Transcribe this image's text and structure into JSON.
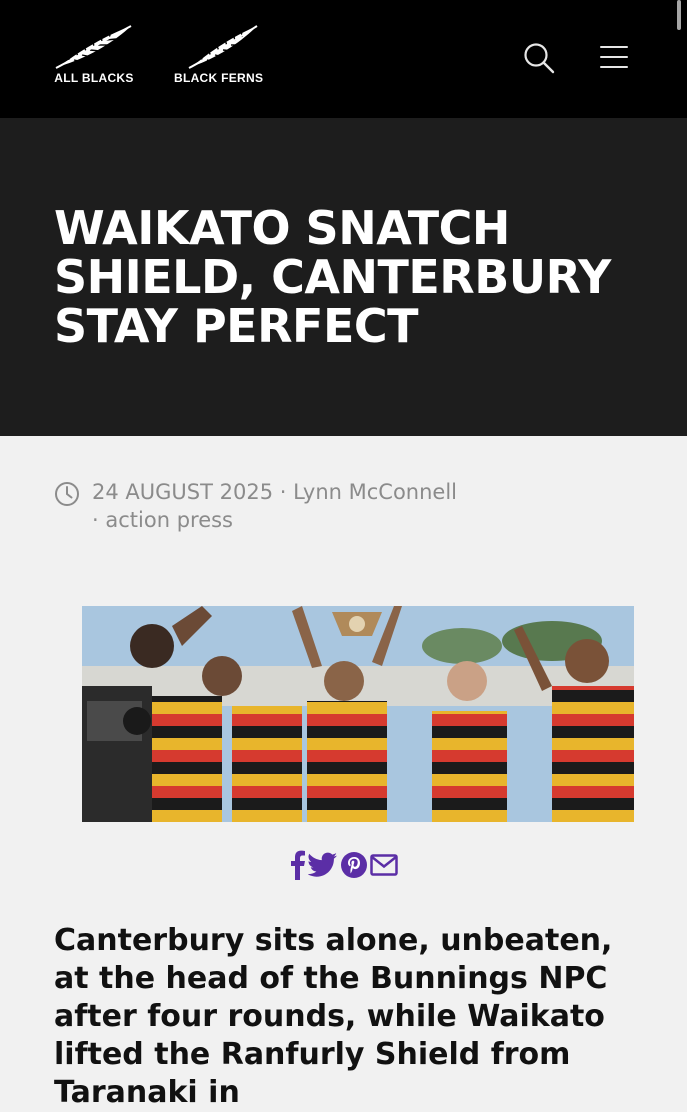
{
  "header": {
    "brand_left": "ALL BLACKS",
    "brand_right": "BLACK FERNS",
    "search_icon": "search-icon",
    "menu_icon": "hamburger-menu-icon"
  },
  "article": {
    "title": "WAIKATO SNATCH SHIELD, CANTERBURY STAY PERFECT",
    "date": "24 AUGUST 2025",
    "author": "Lynn McConnell",
    "credit": "action press",
    "separator": "·",
    "lead": "Canterbury sits alone, unbeaten, at the head of the Bunnings NPC after four rounds, while Waikato lifted the Ranfurly Shield from Taranaki in"
  },
  "share": {
    "icons": [
      "facebook-icon",
      "twitter-icon",
      "pinterest-icon",
      "email-icon"
    ],
    "color": "#5b2ea6"
  },
  "colors": {
    "header_bg": "#000000",
    "hero_bg": "#1d1d1d",
    "page_bg": "#f1f1f1",
    "meta_text": "#8b8b8b"
  }
}
